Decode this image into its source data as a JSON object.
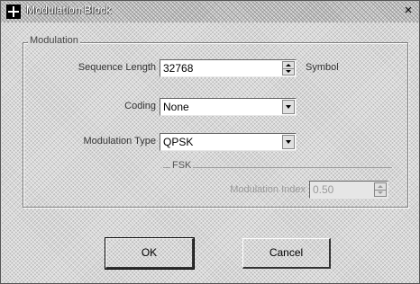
{
  "window": {
    "title": "Modulation Block",
    "close_label": "×"
  },
  "group": {
    "label": "Modulation"
  },
  "fields": {
    "sequence_length": {
      "label": "Sequence Length",
      "value": "32768",
      "unit": "Symbol"
    },
    "coding": {
      "label": "Coding",
      "value": "None"
    },
    "modulation_type": {
      "label": "Modulation Type",
      "value": "QPSK"
    }
  },
  "fsk": {
    "label": "FSK",
    "modulation_index": {
      "label": "Modulation Index",
      "value": "0.50",
      "enabled": false
    }
  },
  "buttons": {
    "ok": "OK",
    "cancel": "Cancel"
  },
  "icons": {
    "app": "app-icon",
    "close": "close-icon"
  }
}
